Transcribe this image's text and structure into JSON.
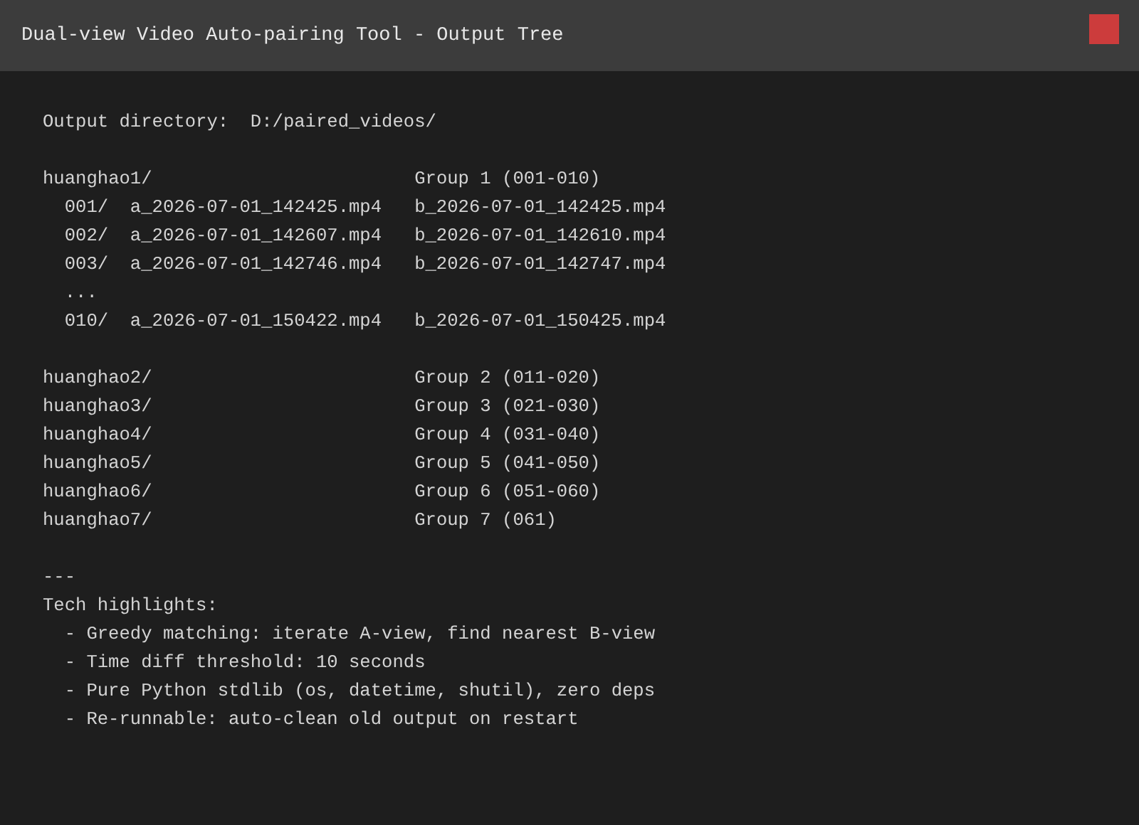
{
  "window": {
    "title": "Dual-view Video Auto-pairing Tool - Output Tree"
  },
  "output_directory": {
    "label": "Output directory:",
    "value": "D:/paired_videos/"
  },
  "folders": [
    {
      "name": "huanghao1/",
      "group": "Group 1 (001-010)",
      "children": [
        {
          "kind": "file",
          "index": "001/",
          "a": "a_2026-07-01_142425.mp4",
          "b": "b_2026-07-01_142425.mp4"
        },
        {
          "kind": "file",
          "index": "002/",
          "a": "a_2026-07-01_142607.mp4",
          "b": "b_2026-07-01_142610.mp4"
        },
        {
          "kind": "file",
          "index": "003/",
          "a": "a_2026-07-01_142746.mp4",
          "b": "b_2026-07-01_142747.mp4"
        },
        {
          "kind": "ellipsis",
          "text": "..."
        },
        {
          "kind": "file",
          "index": "010/",
          "a": "a_2026-07-01_150422.mp4",
          "b": "b_2026-07-01_150425.mp4"
        }
      ]
    },
    {
      "name": "huanghao2/",
      "group": "Group 2 (011-020)"
    },
    {
      "name": "huanghao3/",
      "group": "Group 3 (021-030)"
    },
    {
      "name": "huanghao4/",
      "group": "Group 4 (031-040)"
    },
    {
      "name": "huanghao5/",
      "group": "Group 5 (041-050)"
    },
    {
      "name": "huanghao6/",
      "group": "Group 6 (051-060)"
    },
    {
      "name": "huanghao7/",
      "group": "Group 7 (061)"
    }
  ],
  "separator": "---",
  "highlights": {
    "title": "Tech highlights:",
    "items": [
      "- Greedy matching: iterate A-view, find nearest B-view",
      "- Time diff threshold: 10 seconds",
      "- Pure Python stdlib (os, datetime, shutil), zero deps",
      "- Re-runnable: auto-clean old output on restart"
    ]
  }
}
